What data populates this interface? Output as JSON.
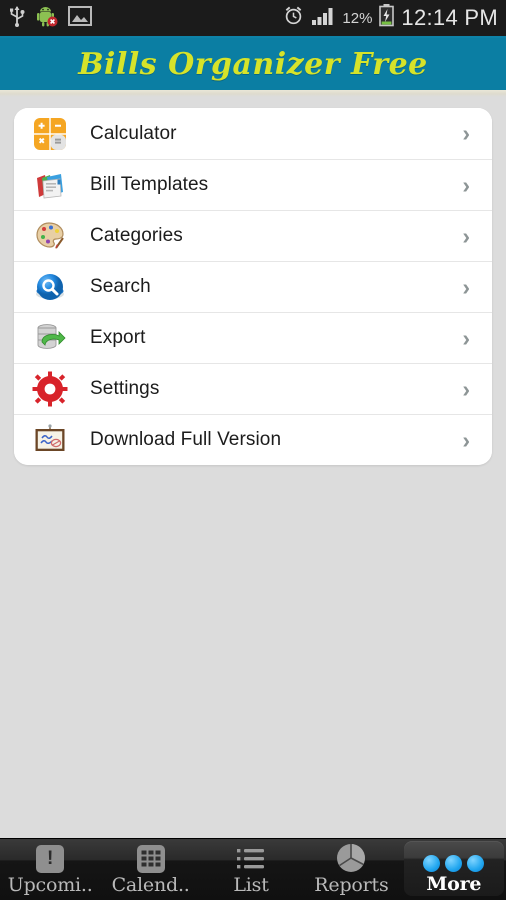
{
  "statusbar": {
    "left_icons": [
      "usb-icon",
      "android-robot-icon",
      "gallery-icon"
    ],
    "alarm_icon": "alarm-clock-icon",
    "signal_icon": "signal-bars-icon",
    "battery_percent": "12%",
    "battery_icon": "battery-charging-icon",
    "time": "12:14 PM"
  },
  "header": {
    "title": "Bills Organizer Free",
    "background_color": "#0b7ea3",
    "title_color": "#d6e32a"
  },
  "menu": {
    "items": [
      {
        "label": "Calculator",
        "icon": "calculator-icon",
        "chevron": "›"
      },
      {
        "label": "Bill Templates",
        "icon": "templates-folders-icon",
        "chevron": "›"
      },
      {
        "label": "Categories",
        "icon": "palette-icon",
        "chevron": "›"
      },
      {
        "label": "Search",
        "icon": "search-magnifier-icon",
        "chevron": "›"
      },
      {
        "label": "Export",
        "icon": "database-export-icon",
        "chevron": "›"
      },
      {
        "label": "Settings",
        "icon": "gear-icon",
        "chevron": "›"
      },
      {
        "label": "Download Full Version",
        "icon": "certificate-frame-icon",
        "chevron": "›"
      }
    ]
  },
  "tabbar": {
    "tabs": [
      {
        "label": "Upcomi..",
        "icon": "exclamation-square-icon",
        "active": false
      },
      {
        "label": "Calend..",
        "icon": "calendar-grid-icon",
        "active": false
      },
      {
        "label": "List",
        "icon": "bullet-list-icon",
        "active": false
      },
      {
        "label": "Reports",
        "icon": "pie-chart-icon",
        "active": false
      },
      {
        "label": "More",
        "icon": "three-dots-icon",
        "active": true
      }
    ]
  }
}
